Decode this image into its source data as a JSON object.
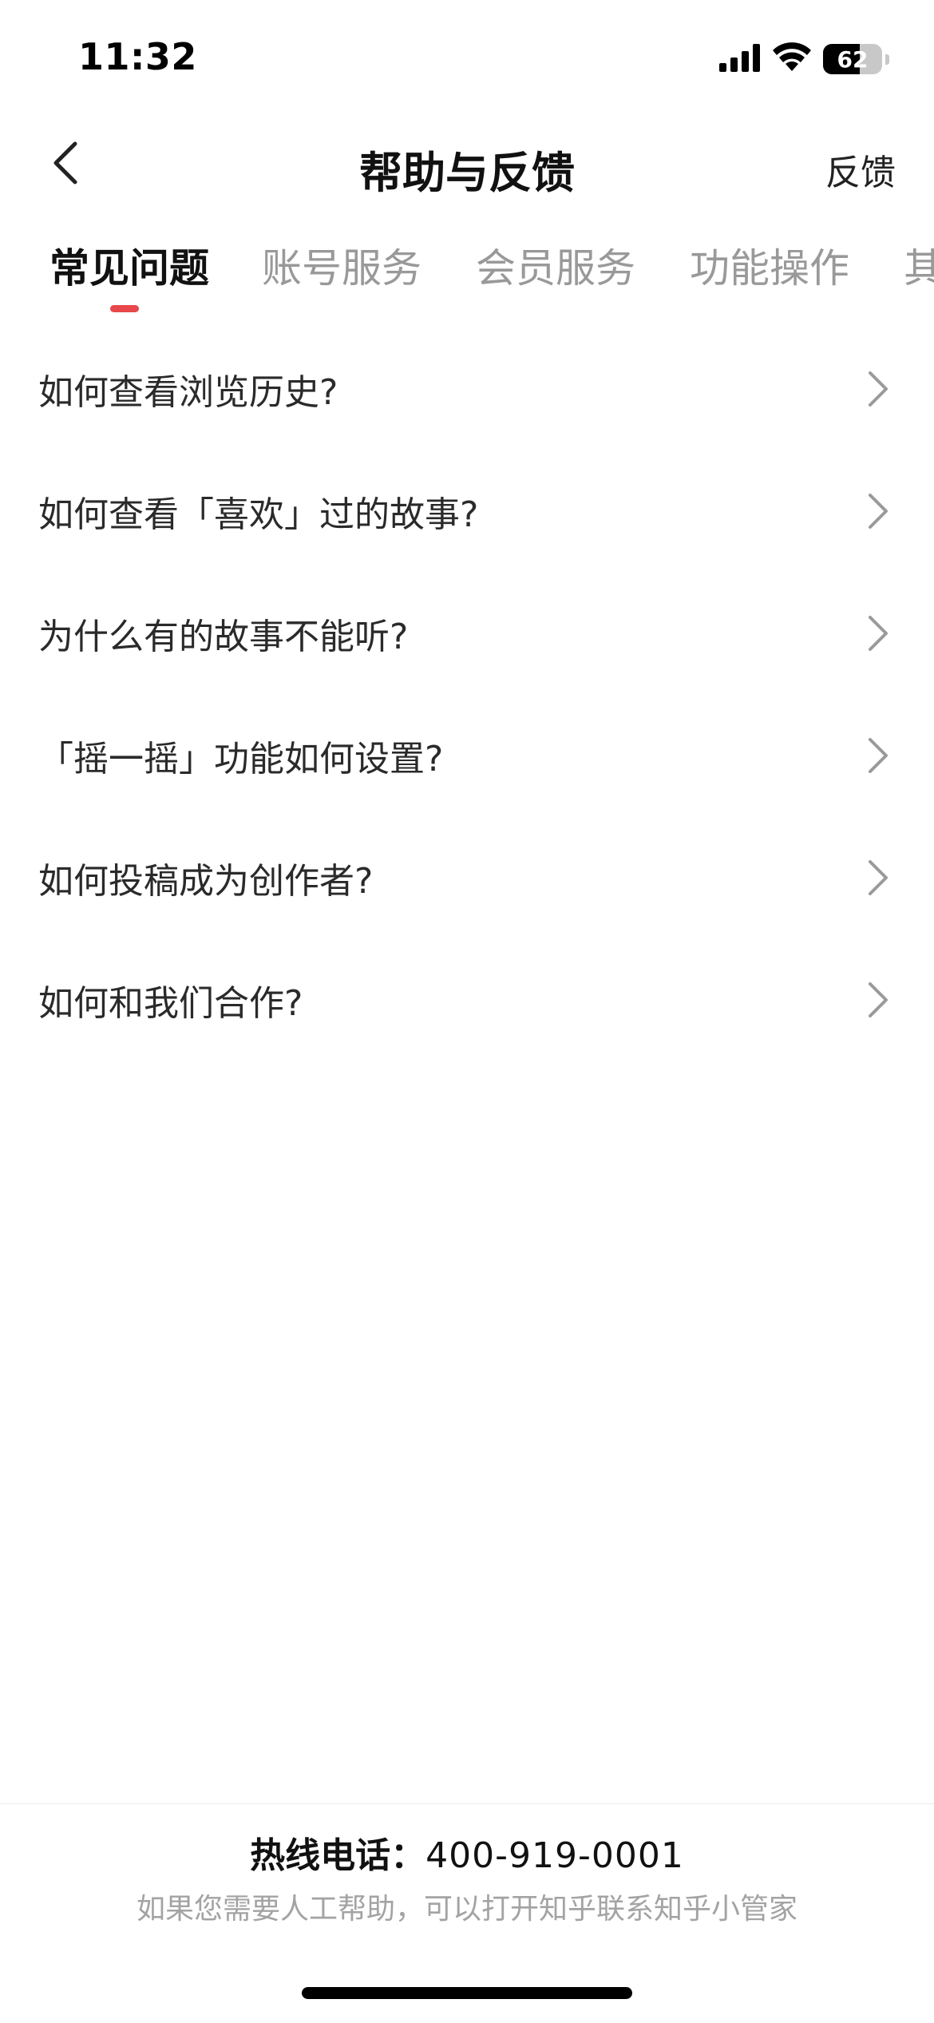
{
  "status_bar": {
    "time": "11:32",
    "battery_level": "62",
    "battery_fraction": 0.62,
    "icons": [
      "cellular-signal-icon",
      "wifi-icon",
      "battery-icon"
    ]
  },
  "nav": {
    "back_icon": "chevron-left-icon",
    "title": "帮助与反馈",
    "feedback_label": "反馈"
  },
  "tabs": [
    {
      "label": "常见问题",
      "active": true
    },
    {
      "label": "账号服务",
      "active": false
    },
    {
      "label": "会员服务",
      "active": false
    },
    {
      "label": "功能操作",
      "active": false
    },
    {
      "label": "其",
      "active": false
    }
  ],
  "faq": [
    {
      "question": "如何查看浏览历史?"
    },
    {
      "question": "如何查看「喜欢」过的故事?"
    },
    {
      "question": "为什么有的故事不能听?"
    },
    {
      "question": "「摇一摇」功能如何设置?"
    },
    {
      "question": "如何投稿成为创作者?"
    },
    {
      "question": "如何和我们合作?"
    }
  ],
  "footer": {
    "hotline_label": "热线电话：",
    "hotline_number": "400-919-0001",
    "hint": "如果您需要人工帮助，可以打开知乎联系知乎小管家"
  },
  "colors": {
    "accent": "#e8474b",
    "inactive_tab": "#999999",
    "hint_text": "#a3a3a3"
  }
}
